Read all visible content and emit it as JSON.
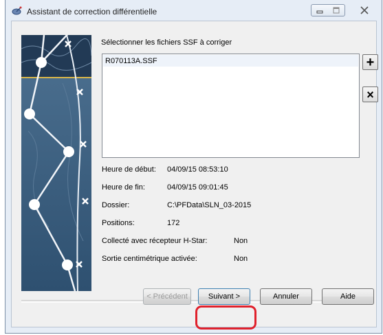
{
  "window": {
    "title": "Assistant de correction différentielle",
    "icon": "satellite-dish-icon"
  },
  "file_panel": {
    "label": "Sélectionner les fichiers SSF à corriger",
    "files": [
      "R070113A.SSF"
    ],
    "add_label": "+",
    "remove_label": "×"
  },
  "info": {
    "start_label": "Heure de début:",
    "start_value": "04/09/15 08:53:10",
    "end_label": "Heure de fin:",
    "end_value": "04/09/15 09:01:45",
    "folder_label": "Dossier:",
    "folder_value": "C:\\PFData\\SLN_03-2015",
    "positions_label": "Positions:",
    "positions_value": "172",
    "hstar_label": "Collecté avec récepteur H-Star:",
    "hstar_value": "Non",
    "centimeter_label": "Sortie centimétrique activée:",
    "centimeter_value": "Non"
  },
  "buttons": {
    "prev": "< Précédent",
    "next": "Suivant >",
    "cancel": "Annuler",
    "help": "Aide"
  },
  "colors": {
    "highlight": "#e0212c",
    "art_blue": "#3c6484",
    "art_line": "#d9b64a"
  }
}
